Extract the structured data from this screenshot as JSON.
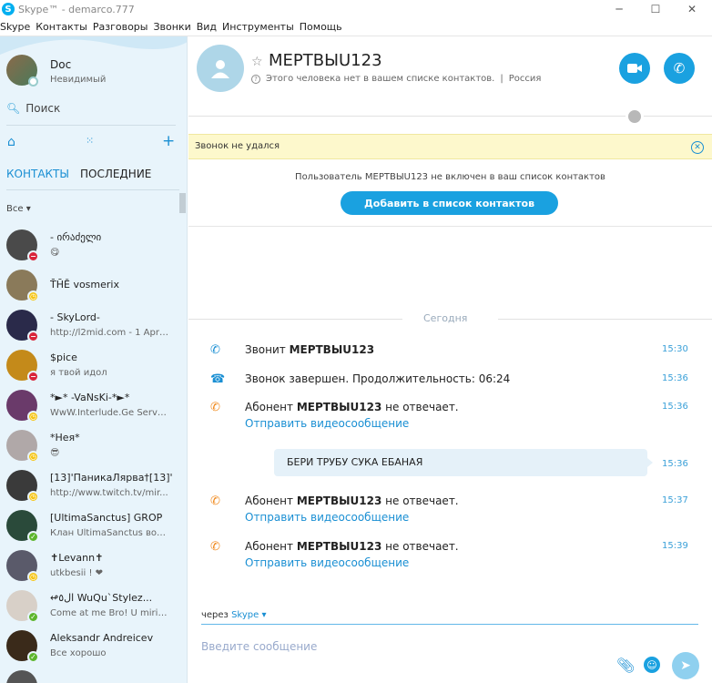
{
  "window": {
    "title": "Skype™ - demarco.777"
  },
  "menu": [
    "Skype",
    "Контакты",
    "Разговоры",
    "Звонки",
    "Вид",
    "Инструменты",
    "Помощь"
  ],
  "me": {
    "name": "Doc",
    "status": "Невидимый"
  },
  "search": {
    "label": "Поиск"
  },
  "tabs": {
    "contacts": "КОНТАКТЫ",
    "recent": "ПОСЛЕДНИЕ"
  },
  "filter": "Все",
  "contacts": [
    {
      "name": "-        ირაძელი",
      "message": "😋",
      "status": "dnd"
    },
    {
      "name": "T̄H̄Ē    vosmerix",
      "message": "",
      "status": "away"
    },
    {
      "name": "- SkyLord-",
      "message": "http://l2mid.com - 1 Apri...",
      "status": "dnd"
    },
    {
      "name": "$pice",
      "message": "я твой идол",
      "status": "dnd"
    },
    {
      "name": "*►* -VaNsKi-*►*",
      "message": "WwW.Interlude.Ge Server...",
      "status": "away"
    },
    {
      "name": "*Нея*",
      "message": "😎",
      "status": "away"
    },
    {
      "name": "[13]'ПаникаЛярва†[13]'",
      "message": "http://www.twitch.tv/mir...",
      "status": "away"
    },
    {
      "name": "[UltimaSanctus] GROP",
      "message": "Клан UltimaSanctus вост...",
      "status": "online"
    },
    {
      "name": "✝Levann✝",
      "message": "utkbesii ! ❤",
      "status": "away"
    },
    {
      "name": "↫ﺍﻝ٥ WuQu`Stylez...",
      "message": "Come at me Bro! U mirin...",
      "status": "online"
    },
    {
      "name": "Aleksandr  Andreicev",
      "message": "Все хорошо",
      "status": "online"
    }
  ],
  "conversation": {
    "name": "МЕРТВЫU123",
    "info": "Этого человека нет в вашем списке контактов.",
    "country": "Россия",
    "banner": "Звонок не удался",
    "notice": "Пользователь МЕРТВЫU123 не включен в ваш список контактов",
    "add_button": "Добавить в список контактов",
    "day": "Сегодня",
    "events": [
      {
        "pre": "Звонит ",
        "bold": "МЕРТВЫU123",
        "post": "",
        "time": "15:30",
        "link": "",
        "icon": "phone-incoming"
      },
      {
        "pre": "Звонок завершен. Продолжительность: 06:24",
        "bold": "",
        "post": "",
        "time": "15:36",
        "link": "",
        "icon": "phone-hangup"
      },
      {
        "pre": "Абонент ",
        "bold": "МЕРТВЫU123",
        "post": " не отвечает.",
        "time": "15:36",
        "link": "Отправить видеосообщение",
        "icon": "phone-missed"
      },
      {
        "pre": "Абонент ",
        "bold": "МЕРТВЫU123",
        "post": " не отвечает.",
        "time": "15:37",
        "link": "Отправить видеосообщение",
        "icon": "phone-missed"
      },
      {
        "pre": "Абонент ",
        "bold": "МЕРТВЫU123",
        "post": " не отвечает.",
        "time": "15:39",
        "link": "Отправить видеосообщение",
        "icon": "phone-missed"
      }
    ],
    "message": {
      "text": "БЕРИ ТРУБУ СУКА ЕБАНАЯ",
      "time": "15:36"
    },
    "via_label": "через",
    "via_service": "Skype",
    "compose_placeholder": "Введите сообщение"
  },
  "colors": {
    "accent": "#1aa1e0",
    "sidebar": "#e8f4fb",
    "banner": "#fdf8cc",
    "missed": "#f08a1e",
    "hangup": "#1a8fd3"
  }
}
